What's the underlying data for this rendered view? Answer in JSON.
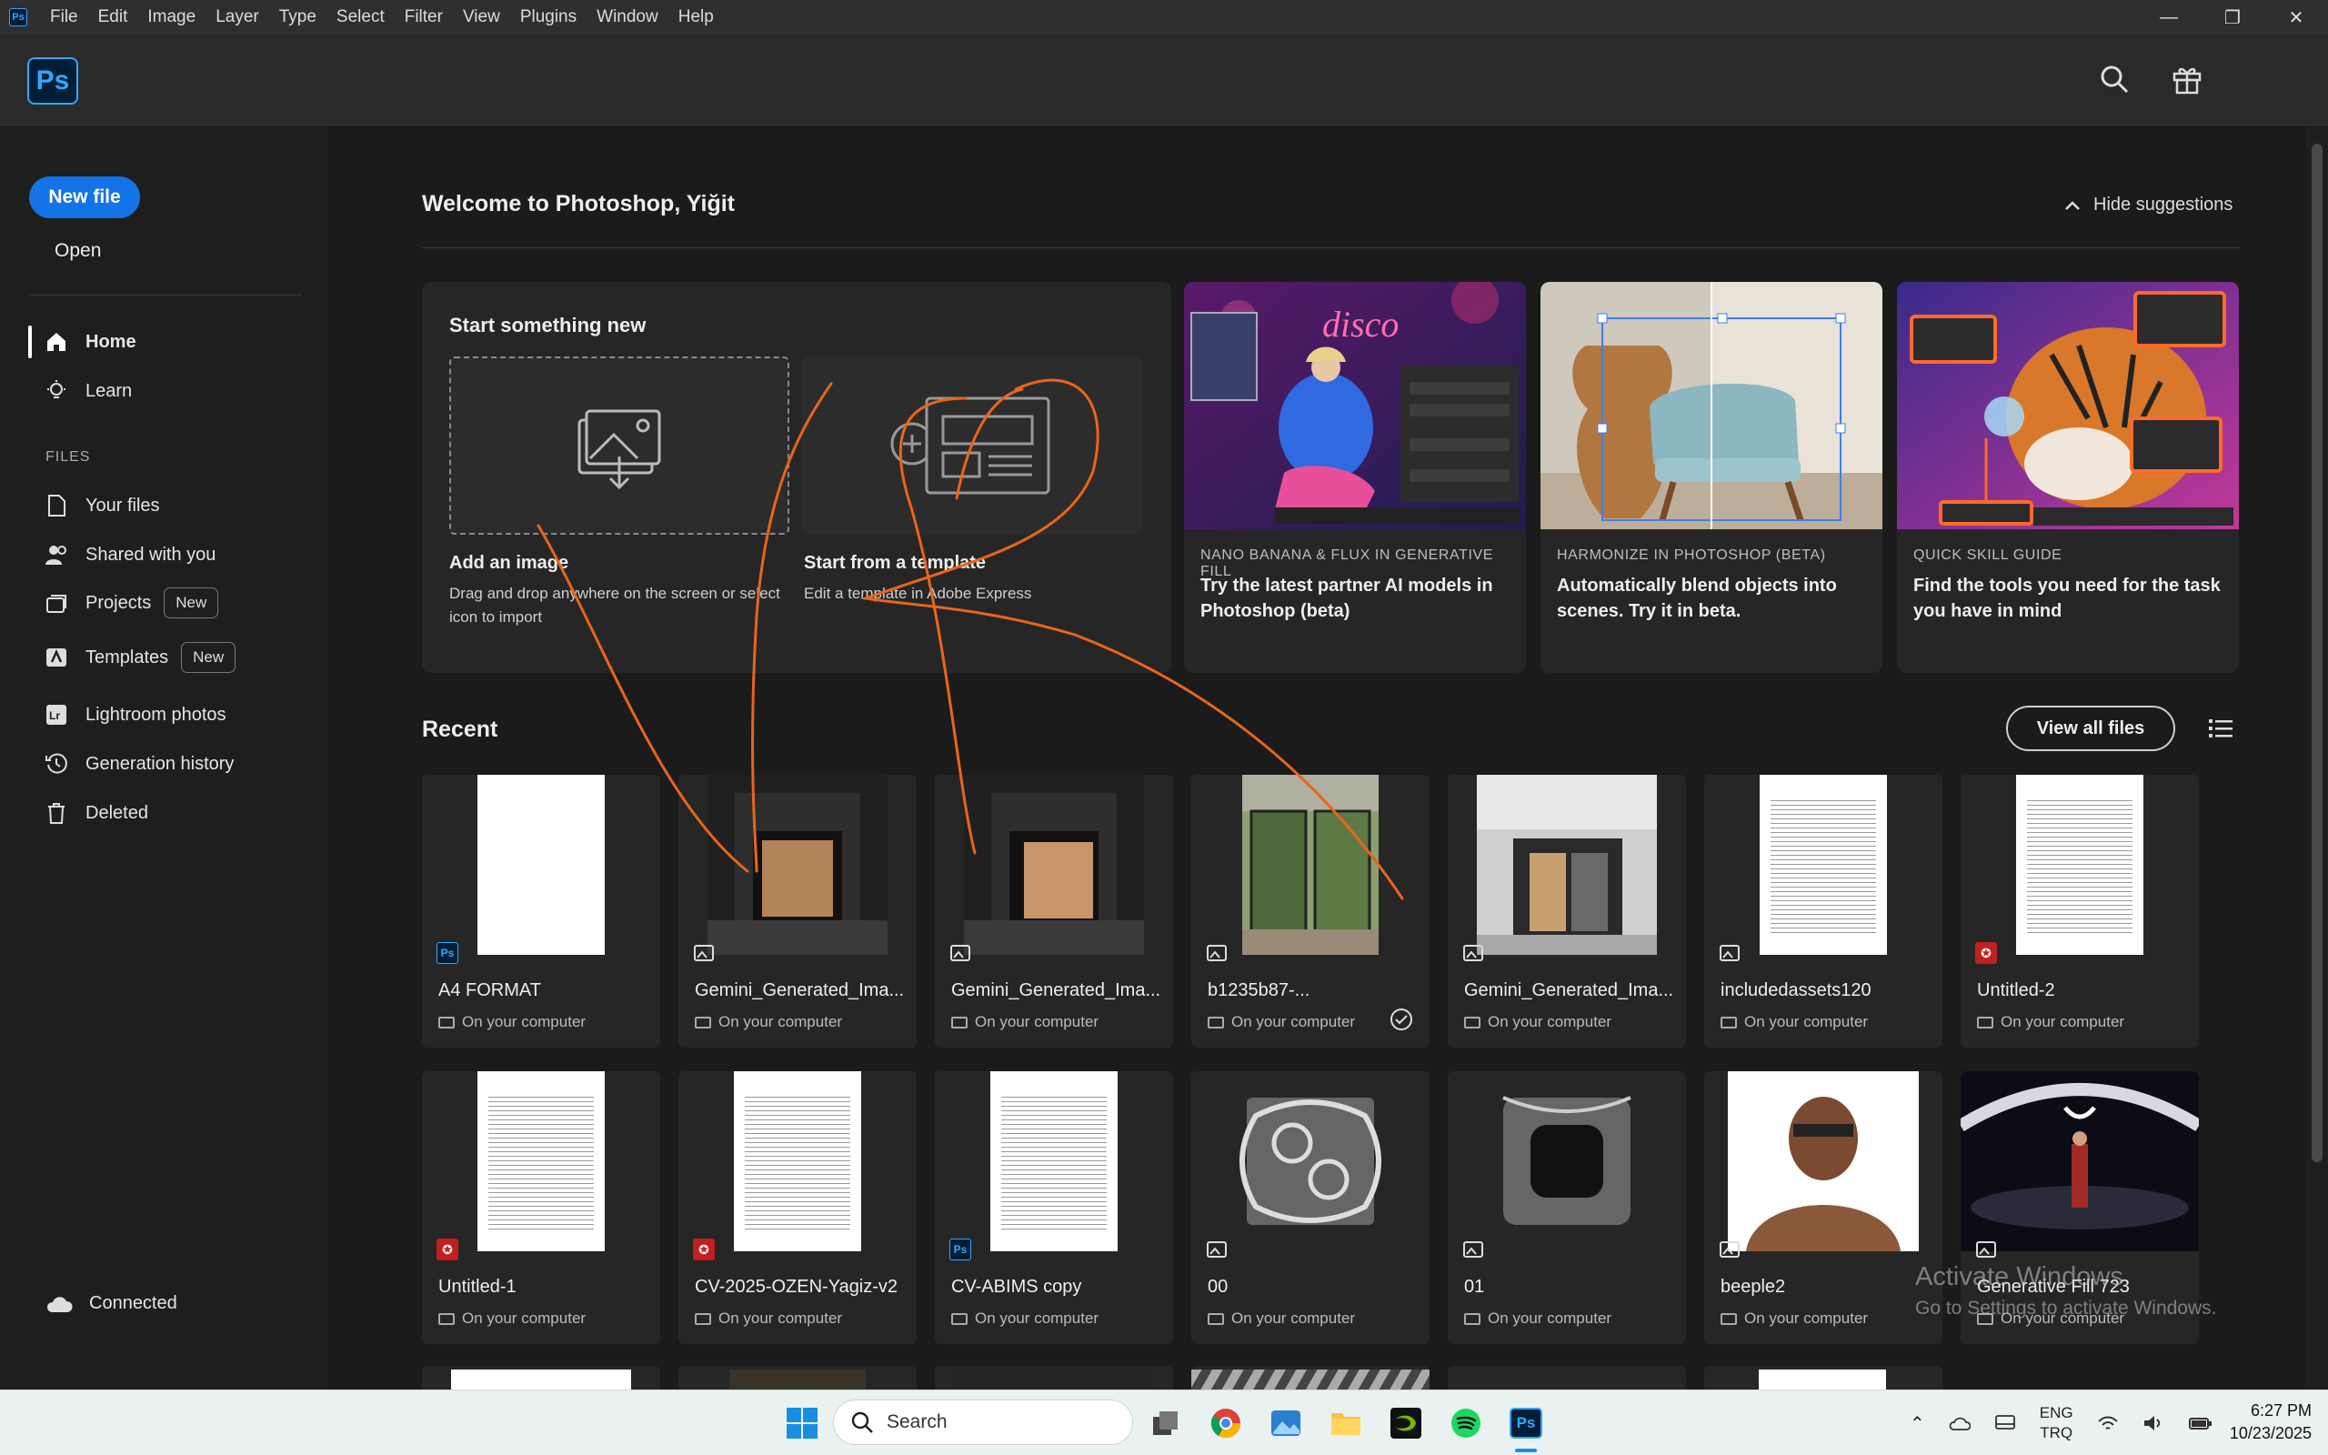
{
  "menubar": {
    "app_icon": "Ps",
    "items": [
      "File",
      "Edit",
      "Image",
      "Layer",
      "Type",
      "Select",
      "Filter",
      "View",
      "Plugins",
      "Window",
      "Help"
    ]
  },
  "header": {
    "logo": "Ps",
    "icons": [
      "search-icon",
      "gift-icon"
    ]
  },
  "sidebar": {
    "new_file": "New file",
    "open": "Open",
    "nav": [
      {
        "label": "Home",
        "icon": "home-icon",
        "active": true
      },
      {
        "label": "Learn",
        "icon": "lightbulb-icon"
      }
    ],
    "files_heading": "FILES",
    "files": [
      {
        "label": "Your files",
        "icon": "file-icon"
      },
      {
        "label": "Shared with you",
        "icon": "shared-users-icon"
      },
      {
        "label": "Projects",
        "icon": "projects-icon",
        "badge": "New"
      },
      {
        "label": "Templates",
        "icon": "templates-icon",
        "badge": "New"
      },
      {
        "label": "Lightroom photos",
        "icon": "lightroom-icon"
      },
      {
        "label": "Generation history",
        "icon": "history-icon"
      },
      {
        "label": "Deleted",
        "icon": "trash-icon"
      }
    ],
    "status": "Connected"
  },
  "main": {
    "welcome": "Welcome to Photoshop, Yiğit",
    "hide_suggestions": "Hide suggestions",
    "start": {
      "heading": "Start something new",
      "add_title": "Add an image",
      "add_desc": "Drag and drop anywhere on the screen or select icon to import",
      "tpl_title": "Start from a template",
      "tpl_desc": "Edit a template in Adobe Express"
    },
    "suggestions": [
      {
        "tag": "NANO BANANA & FLUX IN GENERATIVE FILL",
        "title": "Try the latest partner AI models in Photoshop (beta)",
        "thumb_text": "disco"
      },
      {
        "tag": "HARMONIZE IN PHOTOSHOP (BETA)",
        "title": "Automatically blend objects into scenes. Try it in beta."
      },
      {
        "tag": "QUICK SKILL GUIDE",
        "title": "Find the tools you need for the task you have in mind"
      }
    ],
    "recent_heading": "Recent",
    "view_all": "View all files",
    "files_row1": [
      {
        "name": "A4 FORMAT",
        "loc": "On your computer",
        "type": "ps"
      },
      {
        "name": "Gemini_Generated_Ima...",
        "loc": "On your computer",
        "type": "image"
      },
      {
        "name": "Gemini_Generated_Ima...",
        "loc": "On your computer",
        "type": "image"
      },
      {
        "name": "b1235b87-...",
        "loc": "On your computer",
        "type": "image",
        "synced": true
      },
      {
        "name": "Gemini_Generated_Ima...",
        "loc": "On your computer",
        "type": "image"
      },
      {
        "name": "includedassets120",
        "loc": "On your computer",
        "type": "image"
      },
      {
        "name": "Untitled-2",
        "loc": "On your computer",
        "type": "pdf"
      }
    ],
    "files_row2": [
      {
        "name": "Untitled-1",
        "loc": "On your computer",
        "type": "pdf"
      },
      {
        "name": "CV-2025-OZEN-Yagiz-v2",
        "loc": "On your computer",
        "type": "pdf"
      },
      {
        "name": "CV-ABIMS copy",
        "loc": "On your computer",
        "type": "ps"
      },
      {
        "name": "00",
        "loc": "On your computer",
        "type": "image"
      },
      {
        "name": "01",
        "loc": "On your computer",
        "type": "image"
      },
      {
        "name": "beeple2",
        "loc": "On your computer",
        "type": "image"
      },
      {
        "name": "Generative Fill 723",
        "loc": "On your computer",
        "type": "image"
      }
    ]
  },
  "watermark": {
    "line1": "Activate Windows",
    "line2": "Go to Settings to activate Windows."
  },
  "taskbar": {
    "search_placeholder": "Search",
    "lang_top": "ENG",
    "lang_bottom": "TRQ",
    "time": "6:27 PM",
    "date": "10/23/2025"
  },
  "colors": {
    "accent": "#1473e6",
    "ps_blue": "#31a8ff",
    "annotation": "#e8651d"
  }
}
